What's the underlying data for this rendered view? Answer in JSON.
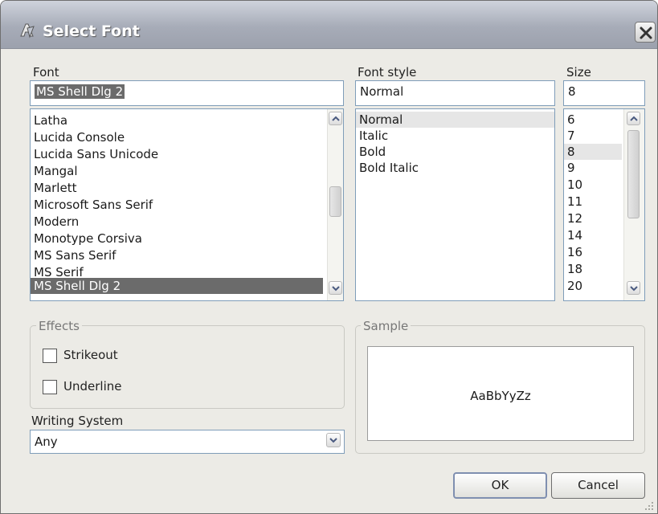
{
  "window": {
    "title": "Select Font",
    "icons": {
      "app": "font-app-icon",
      "close": "close-icon"
    }
  },
  "font": {
    "label": "Font",
    "value": "MS Shell Dlg 2",
    "items": [
      "Latha",
      "Lucida Console",
      "Lucida Sans Unicode",
      "Mangal",
      "Marlett",
      "Microsoft Sans Serif",
      "Modern",
      "Monotype Corsiva",
      "MS Sans Serif",
      "MS Serif",
      "MS Shell Dlg 2"
    ],
    "selected": "MS Shell Dlg 2"
  },
  "font_style": {
    "label": "Font style",
    "value": "Normal",
    "items": [
      "Normal",
      "Italic",
      "Bold",
      "Bold Italic"
    ],
    "selected": "Normal"
  },
  "size": {
    "label": "Size",
    "value": "8",
    "items": [
      "6",
      "7",
      "8",
      "9",
      "10",
      "11",
      "12",
      "14",
      "16",
      "18",
      "20"
    ],
    "selected": "8"
  },
  "effects": {
    "title": "Effects",
    "strikeout_label": "Strikeout",
    "underline_label": "Underline",
    "strikeout_checked": false,
    "underline_checked": false
  },
  "writing_system": {
    "label": "Writing System",
    "value": "Any"
  },
  "sample": {
    "title": "Sample",
    "text": "AaBbYyZz"
  },
  "buttons": {
    "ok": "OK",
    "cancel": "Cancel"
  }
}
